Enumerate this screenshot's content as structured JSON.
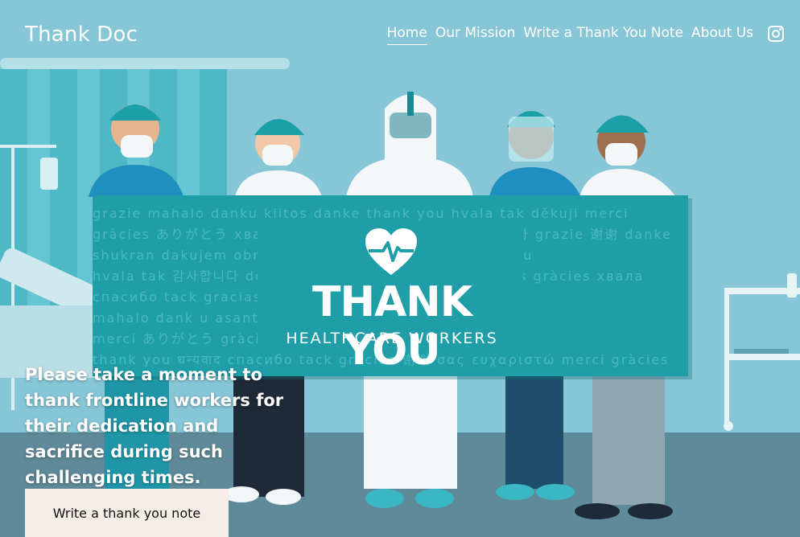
{
  "header": {
    "brand": "Thank Doc",
    "nav": [
      "Home",
      "Our Mission",
      "Write a Thank You Note",
      "About Us"
    ],
    "active_nav": "Home",
    "social_icon": "instagram-icon"
  },
  "banner": {
    "title": "THANK YOU",
    "subtitle": "HEALTHCARE WORKERS",
    "icon": "heart-pulse-icon",
    "background_words": [
      "grazie mahalo danku kiitos danke thank you hvala tak děkuji merci",
      "gràcies ありがとう хвала tack спасибо gracias 감사합니다 grazie 谢谢 danke",
      "shukran dakujem obrigado dank u شكراً danke thank you",
      "hvala tak 감사합니다 děkuji merci thank you merci kiitos gràcies хвала",
      "спасибо tack gracias obrigado grazie",
      "mahalo dank u asante děkuji thank you",
      "merci ありがとう gràcies asante danke хвала",
      "thank you धन्यवाद спасибо tack gracias 谢谢 σας ευχαριστώ merci gràcies"
    ]
  },
  "hero": {
    "tagline": "Please take a moment to thank frontline workers for their dedication and sacrifice during such challenging times.",
    "cta_label": "Write a thank you note"
  },
  "colors": {
    "sky": "#86c6d6",
    "teal_banner": "#1f9ea8",
    "floor": "#5f8a99",
    "button_bg": "#f7ede8"
  }
}
